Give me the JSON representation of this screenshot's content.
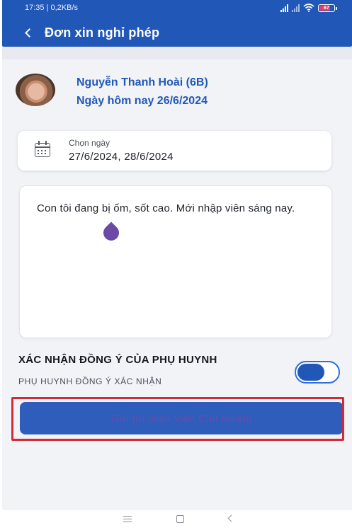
{
  "status_bar": {
    "time_speed": "17:35 | 0,2KB/s",
    "battery": "67"
  },
  "header": {
    "title": "Đơn xin nghỉ phép"
  },
  "student": {
    "name": "Nguyễn Thanh Hoài (6B)",
    "today": "Ngày hôm nay 26/6/2024"
  },
  "date_picker": {
    "label": "Chọn ngày",
    "value": "27/6/2024, 28/6/2024"
  },
  "reason": {
    "text": "Con tôi đang bị ốm, sốt cao. Mới nhập viên sáng nay."
  },
  "consent": {
    "title": "XÁC NHẬN ĐỒNG Ý CỦA PHỤ HUYNH",
    "subtitle": "PHỤ HUYNH ĐỒNG Ý XÁC NHẬN",
    "enabled": true
  },
  "submit": {
    "label": "Gửi tới Giáo Viên Chủ Nhiệm"
  },
  "colors": {
    "header": "#2158b8",
    "accent_text": "#2158b8",
    "button": "#2f5dbb",
    "highlight": "#d02a3a"
  },
  "icons": {
    "back": "chevron-left-icon",
    "calendar": "calendar-icon",
    "nav_menu": "menu-icon",
    "nav_home": "square-home-icon",
    "nav_back": "back-triangle-icon"
  }
}
